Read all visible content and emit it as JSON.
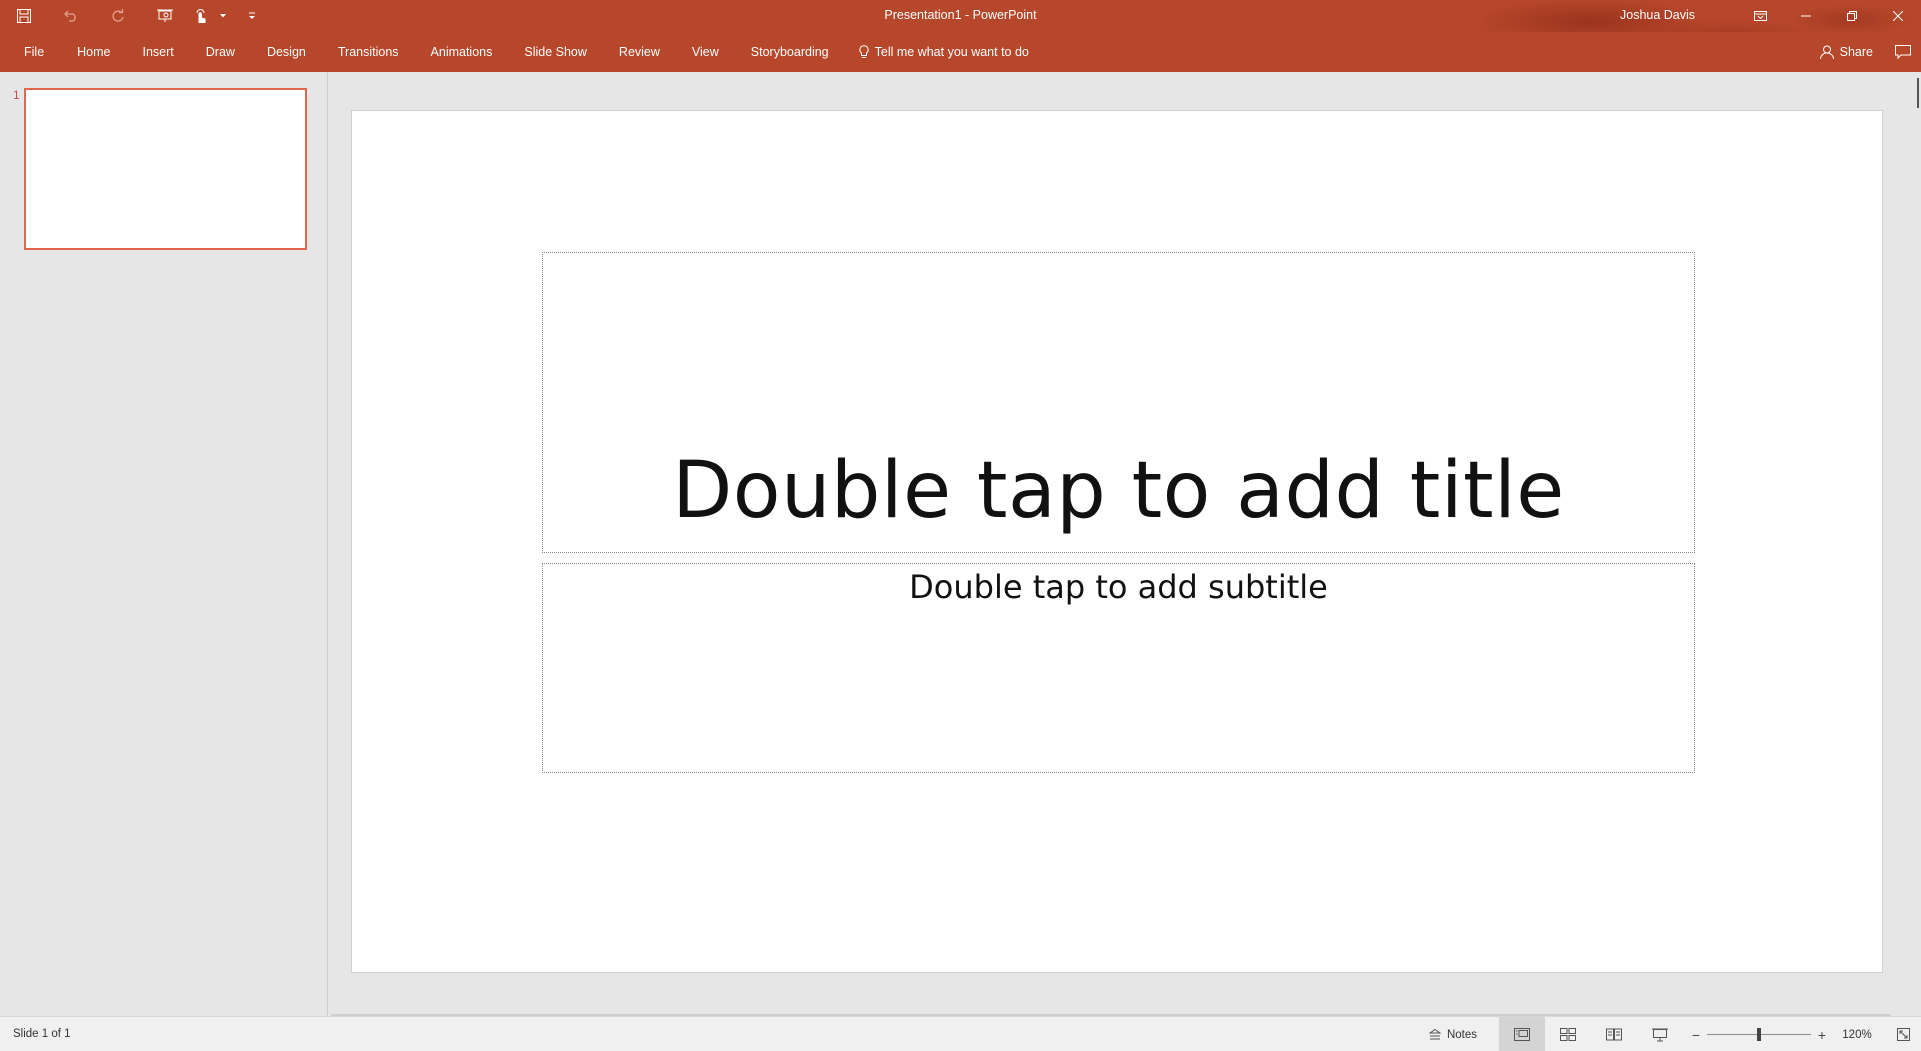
{
  "window": {
    "title": "Presentation1 - PowerPoint",
    "user": "Joshua Davis"
  },
  "qat": {
    "icons": [
      "save-icon",
      "undo-icon",
      "redo-icon",
      "slideshow-from-beginning-icon",
      "touch-mouse-mode-icon",
      "customize-toolbar-icon"
    ]
  },
  "ribbon": {
    "tabs": [
      {
        "id": "file",
        "label": "File"
      },
      {
        "id": "home",
        "label": "Home"
      },
      {
        "id": "insert",
        "label": "Insert"
      },
      {
        "id": "draw",
        "label": "Draw"
      },
      {
        "id": "design",
        "label": "Design"
      },
      {
        "id": "transitions",
        "label": "Transitions"
      },
      {
        "id": "animations",
        "label": "Animations"
      },
      {
        "id": "slide-show",
        "label": "Slide Show"
      },
      {
        "id": "review",
        "label": "Review"
      },
      {
        "id": "view",
        "label": "View"
      },
      {
        "id": "storyboarding",
        "label": "Storyboarding"
      }
    ],
    "tell_me": "Tell me what you want to do",
    "share": "Share"
  },
  "thumbnails": [
    {
      "number": "1",
      "selected": true
    }
  ],
  "slide": {
    "title_placeholder": "Double tap to add title",
    "subtitle_placeholder": "Double tap to add subtitle"
  },
  "status": {
    "slide_count": "Slide 1 of 1",
    "notes": "Notes",
    "zoom_level": "120%",
    "zoom_fraction": 0.5
  },
  "colors": {
    "accent": "#b7472a",
    "thumbnail_selection": "#e0674a"
  }
}
